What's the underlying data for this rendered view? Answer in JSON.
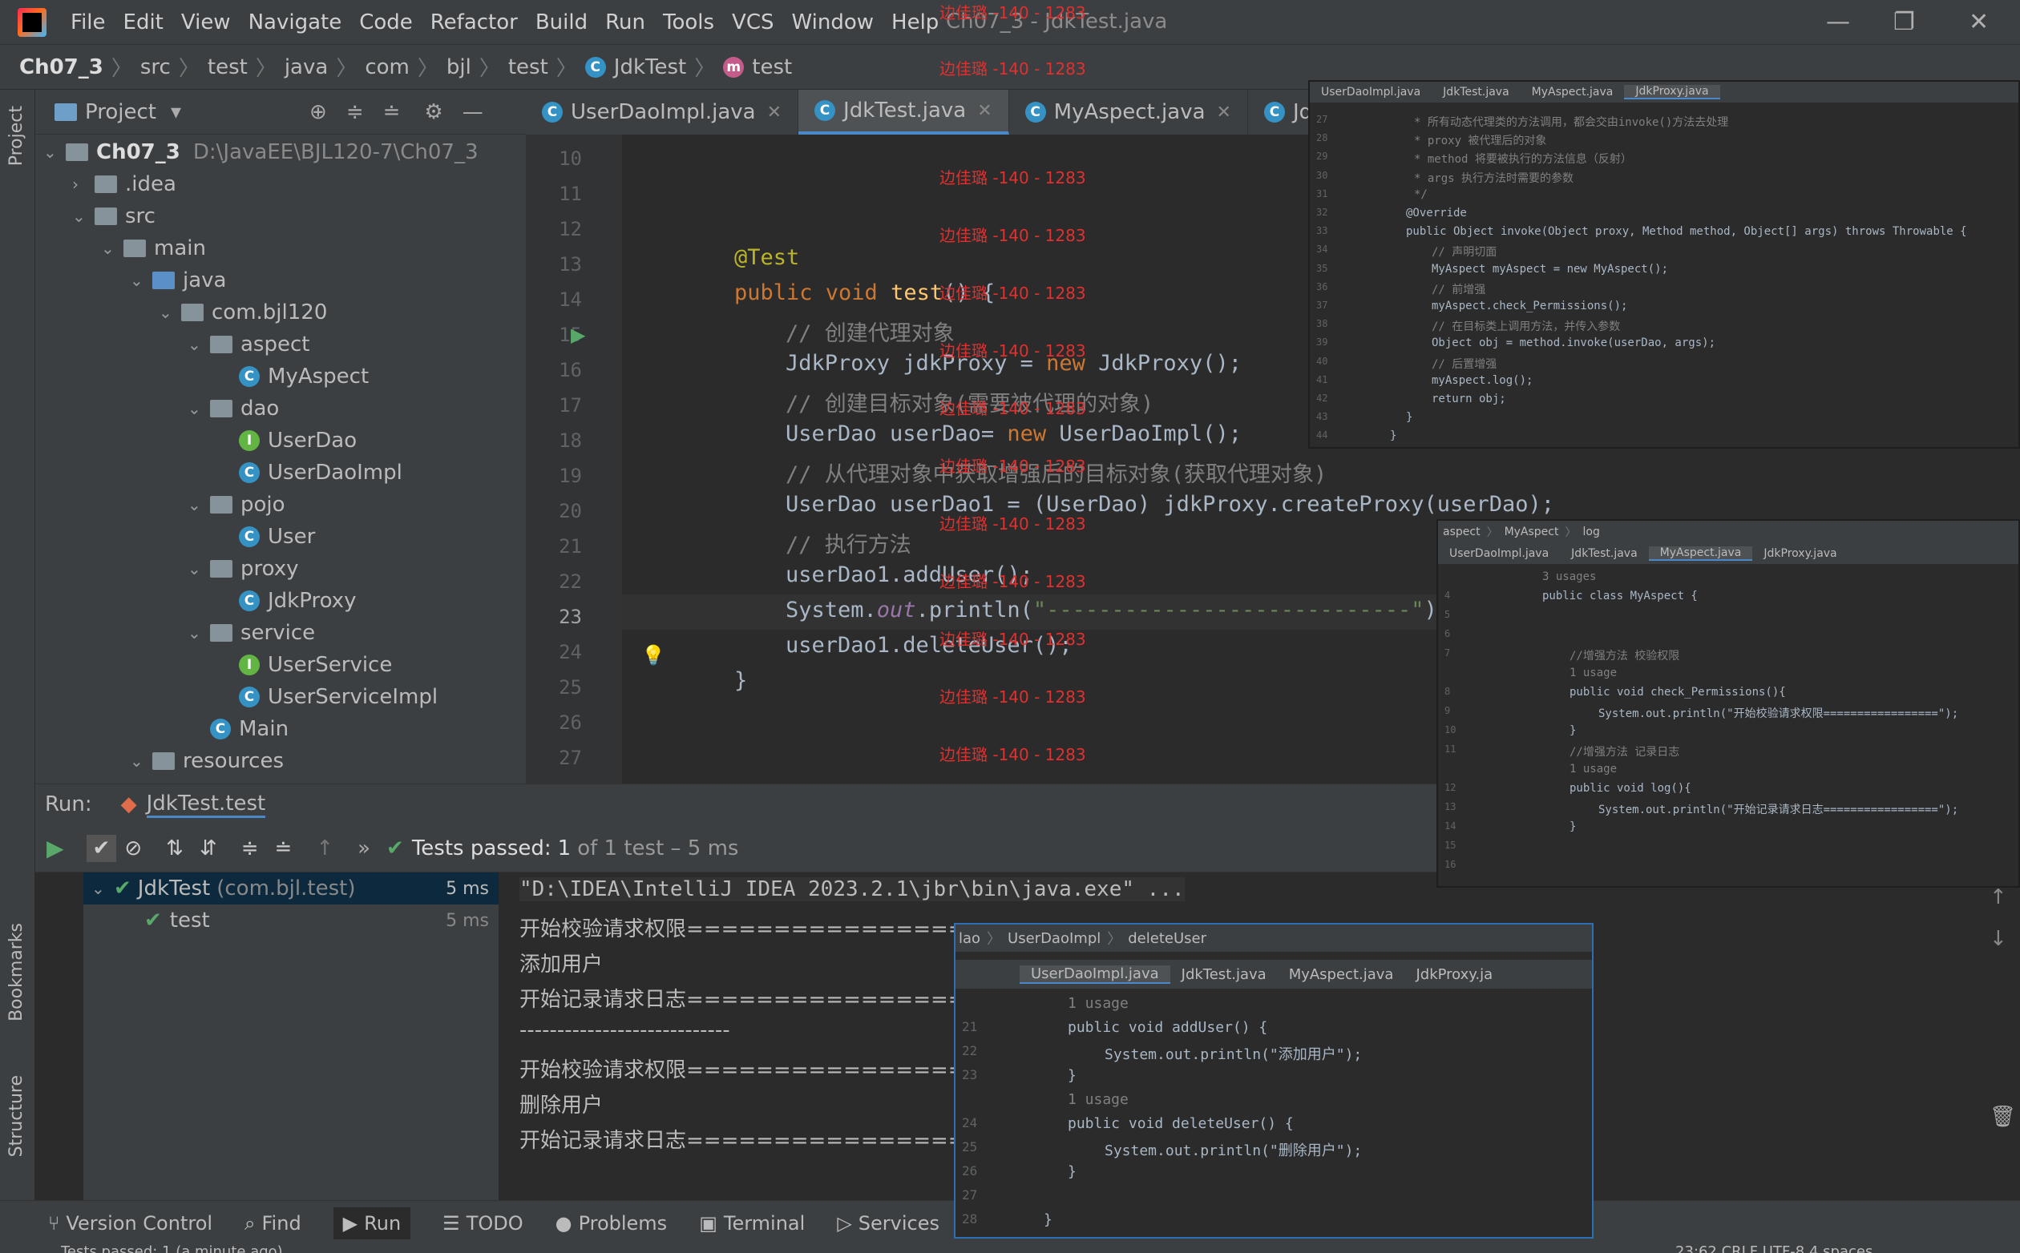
{
  "menu": {
    "items": [
      "File",
      "Edit",
      "View",
      "Navigate",
      "Code",
      "Refactor",
      "Build",
      "Run",
      "Tools",
      "VCS",
      "Window",
      "Help"
    ],
    "window_title": "Ch07_3 - JdkTest.java"
  },
  "breadcrumb": [
    "Ch07_3",
    "src",
    "test",
    "java",
    "com",
    "bjl",
    "test",
    "JdkTest",
    "test"
  ],
  "project": {
    "title": "Project",
    "root": "Ch07_3",
    "root_path": "D:\\JavaEE\\BJL120-7\\Ch07_3",
    "items": [
      ".idea",
      "src",
      "main",
      "java",
      "com.bjl120",
      "aspect",
      "MyAspect",
      "dao",
      "UserDao",
      "UserDaoImpl",
      "pojo",
      "User",
      "proxy",
      "JdkProxy",
      "service",
      "UserService",
      "UserServiceImpl",
      "Main",
      "resources"
    ]
  },
  "editor": {
    "tabs": [
      "UserDaoImpl.java",
      "JdkTest.java",
      "MyAspect.java",
      "JdkProxy."
    ],
    "line_numbers": [
      "10",
      "11",
      "12",
      "13",
      "14",
      "15",
      "16",
      "17",
      "18",
      "19",
      "20",
      "21",
      "22",
      "23",
      "24",
      "25",
      "26",
      "27"
    ],
    "code": {
      "l13": "@Test",
      "l14a": "public void ",
      "l14b": "test",
      "l14c": "() {",
      "l15": "// 创建代理对象",
      "l16a": "JdkProxy jdkProxy = ",
      "l16b": "new ",
      "l16c": "JdkProxy();",
      "l17": "// 创建目标对象(需要被代理的对象)",
      "l18a": "UserDao userDao= ",
      "l18b": "new ",
      "l18c": "UserDaoImpl();",
      "l19": "// 从代理对象中获取增强后的目标对象(获取代理对象)",
      "l20": "UserDao userDao1 = (UserDao) jdkProxy.createProxy(userDao);",
      "l21": "// 执行方法",
      "l22": "userDao1.addUser();",
      "l23a": "System.",
      "l23b": "out",
      "l23c": ".println(",
      "l23d": "\"----------------------------\"",
      "l23e": ")",
      "l24": "userDao1.deleteUser();",
      "l25": "}"
    }
  },
  "watermark": "边佳璐 -140 - 1283",
  "run": {
    "label": "Run:",
    "config": "JdkTest.test",
    "status_prefix": "Tests passed:",
    "status_count": "1",
    "status_suffix": "of 1 test – 5 ms",
    "tree": [
      {
        "name": "JdkTest",
        "pkg": "(com.bjl.test)",
        "time": "5 ms"
      },
      {
        "name": "test",
        "time": "5 ms"
      }
    ],
    "console": [
      "\"D:\\IDEA\\IntelliJ IDEA 2023.2.1\\jbr\\bin\\java.exe\" ...",
      "开始校验请求权限=================",
      "添加用户",
      "开始记录请求日志=================",
      "----------------------------",
      "开始校验请求权限=================",
      "删除用户",
      "开始记录请求日志================="
    ]
  },
  "bottom": [
    "Version Control",
    "Find",
    "Run",
    "TODO",
    "Problems",
    "Terminal",
    "Services"
  ],
  "status": {
    "left": "Tests passed: 1 (a minute ago)",
    "right": "23:62   CRLF   UTF-8   4 spaces"
  },
  "overlay1": {
    "tabs": [
      "UserDaoImpl.java",
      "JdkTest.java",
      "MyAspect.java",
      "JdkProxy.java"
    ],
    "lines": [
      "* 所有动态代理类的方法调用，都会交由invoke()方法去处理",
      "* proxy 被代理后的对象",
      "* method 将要被执行的方法信息（反射）",
      "* args 执行方法时需要的参数",
      "*/",
      "@Override",
      "public Object invoke(Object proxy, Method method, Object[] args) throws Throwable {",
      "// 声明切面",
      "MyAspect myAspect = new MyAspect();",
      "// 前增强",
      "myAspect.check_Permissions();",
      "// 在目标类上调用方法，并传入参数",
      "Object obj = method.invoke(userDao, args);",
      "// 后置增强",
      "myAspect.log();",
      "return obj;",
      "}",
      "}"
    ],
    "nums": [
      "27",
      "28",
      "29",
      "30",
      "31",
      "32",
      "33",
      "34",
      "35",
      "36",
      "37",
      "38",
      "39",
      "40",
      "41",
      "42",
      "43",
      "44"
    ]
  },
  "overlay2": {
    "crumb": [
      "aspect",
      "MyAspect",
      "log"
    ],
    "tabs": [
      "UserDaoImpl.java",
      "JdkTest.java",
      "MyAspect.java",
      "JdkProxy.java"
    ],
    "lines": [
      "3 usages",
      "public class MyAspect {",
      "",
      "",
      "//增强方法 校验权限",
      "1 usage",
      "public void check_Permissions(){",
      "System.out.println(\"开始校验请求权限=================\");",
      "}",
      "//增强方法 记录日志",
      "1 usage",
      "public void log(){",
      "System.out.println(\"开始记录请求日志=================\");",
      "}",
      "",
      ""
    ],
    "nums": [
      "",
      "4",
      "5",
      "6",
      "7",
      "",
      "8",
      "9",
      "10",
      "11",
      "",
      "12",
      "13",
      "14",
      "15",
      "16"
    ]
  },
  "overlay3": {
    "crumb": [
      "lao",
      "UserDaoImpl",
      "deleteUser"
    ],
    "tabs": [
      "UserDaoImpl.java",
      "JdkTest.java",
      "MyAspect.java",
      "JdkProxy.ja"
    ],
    "lines": [
      "1 usage",
      "public void addUser() {",
      "System.out.println(\"添加用户\");",
      "}",
      "1 usage",
      "public void deleteUser() {",
      "System.out.println(\"删除用户\");",
      "}",
      "",
      "}"
    ],
    "nums": [
      "",
      "21",
      "22",
      "23",
      "",
      "24",
      "25",
      "26",
      "27",
      "28"
    ]
  }
}
